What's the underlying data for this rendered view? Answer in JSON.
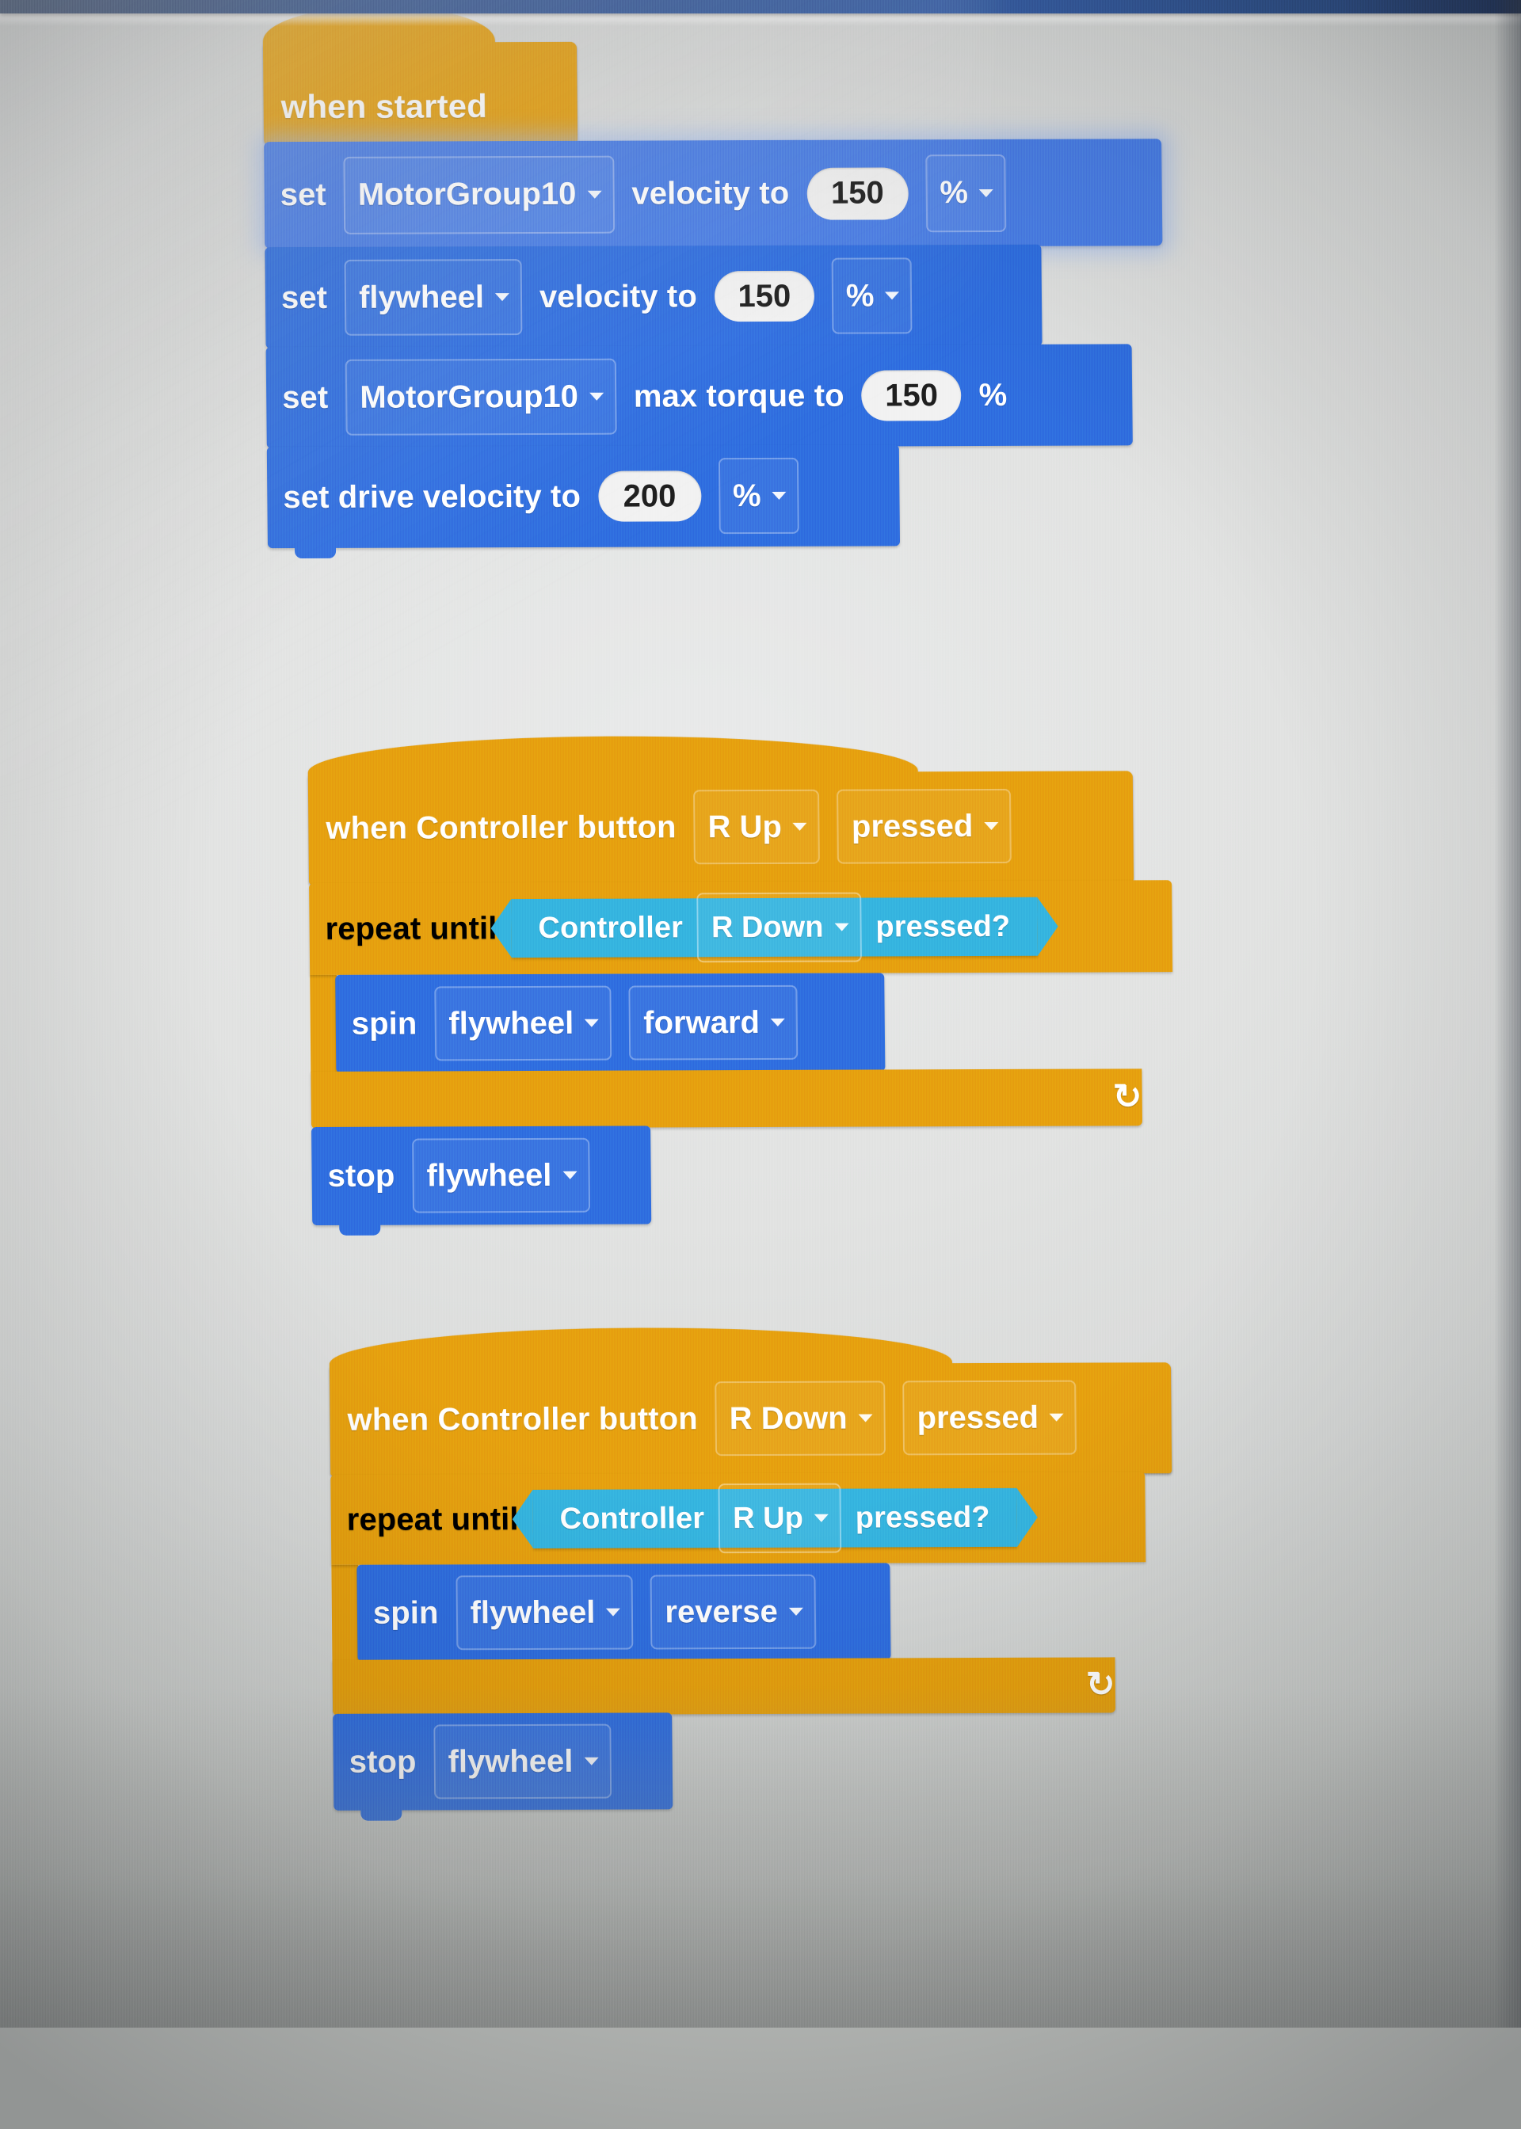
{
  "app": {
    "name": "VEXcode Blocks workspace",
    "background_color": "#e2e3e2",
    "titlebar_color": "#33548f"
  },
  "palette": {
    "event_block": "#e6a00f",
    "motion_block": "#2f6ee0",
    "sensing_block": "#35b4e0",
    "input_oval": "#f2f2f2"
  },
  "icons": {
    "dropdown_caret": "dropdown-caret-icon",
    "loop_arrow": "↺"
  },
  "stacks": [
    {
      "id": "stack-when-started",
      "hat": {
        "label": "when started"
      },
      "blocks": [
        {
          "type": "set-motor-velocity",
          "highlighted": true,
          "parts": [
            {
              "kind": "label",
              "text": "set"
            },
            {
              "kind": "dropdown",
              "value": "MotorGroup10"
            },
            {
              "kind": "label",
              "text": "velocity to"
            },
            {
              "kind": "oval",
              "value": "150"
            },
            {
              "kind": "dropdown",
              "value": "%"
            }
          ]
        },
        {
          "type": "set-motor-velocity",
          "highlighted": false,
          "parts": [
            {
              "kind": "label",
              "text": "set"
            },
            {
              "kind": "dropdown",
              "value": "flywheel"
            },
            {
              "kind": "label",
              "text": "velocity to"
            },
            {
              "kind": "oval",
              "value": "150"
            },
            {
              "kind": "dropdown",
              "value": "%"
            }
          ]
        },
        {
          "type": "set-max-torque",
          "highlighted": false,
          "parts": [
            {
              "kind": "label",
              "text": "set"
            },
            {
              "kind": "dropdown",
              "value": "MotorGroup10"
            },
            {
              "kind": "label",
              "text": "max torque to"
            },
            {
              "kind": "oval",
              "value": "150"
            },
            {
              "kind": "label",
              "text": "%"
            }
          ]
        },
        {
          "type": "set-drive-velocity",
          "highlighted": false,
          "parts": [
            {
              "kind": "label",
              "text": "set drive velocity to"
            },
            {
              "kind": "oval",
              "value": "200"
            },
            {
              "kind": "dropdown",
              "value": "%"
            }
          ]
        }
      ]
    },
    {
      "id": "stack-controller-r-up",
      "hat": {
        "label": "when Controller button",
        "button": "R Up",
        "state": "pressed"
      },
      "loop": {
        "label": "repeat until",
        "condition": {
          "prefix": "Controller",
          "button": "R Down",
          "suffix": "pressed?"
        },
        "body": [
          {
            "type": "spin",
            "parts": [
              {
                "kind": "label",
                "text": "spin"
              },
              {
                "kind": "dropdown",
                "value": "flywheel"
              },
              {
                "kind": "dropdown",
                "value": "forward"
              }
            ]
          }
        ]
      },
      "after": [
        {
          "type": "stop-motor",
          "parts": [
            {
              "kind": "label",
              "text": "stop"
            },
            {
              "kind": "dropdown",
              "value": "flywheel"
            }
          ]
        }
      ]
    },
    {
      "id": "stack-controller-r-down",
      "hat": {
        "label": "when Controller button",
        "button": "R Down",
        "state": "pressed"
      },
      "loop": {
        "label": "repeat until",
        "condition": {
          "prefix": "Controller",
          "button": "R Up",
          "suffix": "pressed?"
        },
        "body": [
          {
            "type": "spin",
            "parts": [
              {
                "kind": "label",
                "text": "spin"
              },
              {
                "kind": "dropdown",
                "value": "flywheel"
              },
              {
                "kind": "dropdown",
                "value": "reverse"
              }
            ]
          }
        ]
      },
      "after": [
        {
          "type": "stop-motor",
          "parts": [
            {
              "kind": "label",
              "text": "stop"
            },
            {
              "kind": "dropdown",
              "value": "flywheel"
            }
          ]
        }
      ]
    }
  ]
}
